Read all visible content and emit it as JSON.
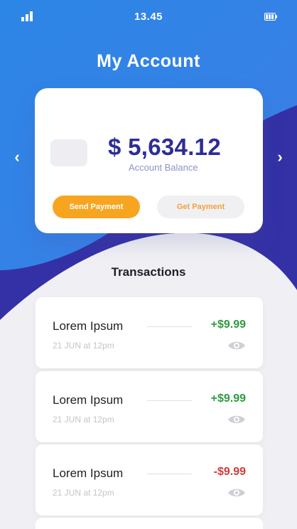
{
  "status_bar": {
    "time": "13.45",
    "signal_icon": "signal-bars-icon",
    "battery_icon": "battery-icon"
  },
  "header": {
    "title": "My Account"
  },
  "nav": {
    "prev_icon": "chevron-left-icon",
    "prev_glyph": "‹",
    "next_icon": "chevron-right-icon",
    "next_glyph": "›"
  },
  "balance_card": {
    "amount": "$ 5,634.12",
    "label": "Account Balance",
    "send_button": "Send Payment",
    "get_button": "Get Payment"
  },
  "transactions": {
    "title": "Transactions",
    "items": [
      {
        "name": "Lorem Ipsum",
        "date": "21 JUN at 12pm",
        "amount": "+$9.99",
        "type": "credit"
      },
      {
        "name": "Lorem Ipsum",
        "date": "21 JUN at 12pm",
        "amount": "+$9.99",
        "type": "credit"
      },
      {
        "name": "Lorem Ipsum",
        "date": "21 JUN at 12pm",
        "amount": "-$9.99",
        "type": "debit"
      }
    ]
  },
  "colors": {
    "primary_blue": "#2f87e8",
    "deep_indigo": "#2e2d96",
    "accent_orange": "#f7a521",
    "positive": "#2e9b3e",
    "negative": "#d23a3a",
    "background": "#f0f0f4"
  }
}
